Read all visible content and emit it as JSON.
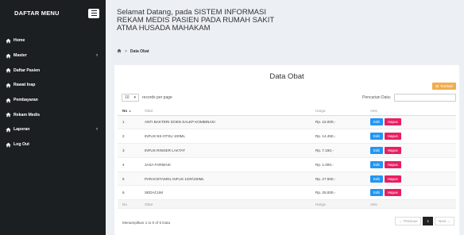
{
  "sidebar": {
    "title": "DAFTAR MENU",
    "items": [
      {
        "label": "Home",
        "caret": ""
      },
      {
        "label": "Master",
        "caret": "›"
      },
      {
        "label": "Daftar Pasien",
        "caret": ""
      },
      {
        "label": "Rawat Inap",
        "caret": ""
      },
      {
        "label": "Pembayaran",
        "caret": ""
      },
      {
        "label": "Rekam Medis",
        "caret": ""
      },
      {
        "label": "Laporan",
        "caret": "›"
      },
      {
        "label": "Log Out",
        "caret": ""
      }
    ]
  },
  "header": {
    "line1": "Selamat Datang, pada SISTEM INFORMASI",
    "line2": "REKAM MEDIS PASIEN PADA RUMAH SAKIT",
    "line3": "ATMA HUSADA MAHAKAM"
  },
  "breadcrumb": {
    "current": "Data Obat"
  },
  "panel": {
    "title": "Data Obat",
    "add_label": "Tambah",
    "length_value": "10",
    "length_suffix": "records per page",
    "search_label": "Pencarian Data:",
    "search_value": ""
  },
  "table": {
    "headers": {
      "no": "No",
      "obat": "Obat",
      "harga": "Harga",
      "aksi": "Aksi"
    },
    "rows": [
      {
        "no": "1",
        "obat": "ANTI BAKTERI DOEN SALEP KOMBINASI",
        "harga": "Rp. 15.000,-"
      },
      {
        "no": "2",
        "obat": "INFUS NS-OTSU 100ML",
        "harga": "Rp. 14.450,-"
      },
      {
        "no": "3",
        "obat": "INFUS RINGER LAKTAT",
        "harga": "Rp. 7.150,-"
      },
      {
        "no": "4",
        "obat": "JASA FARMASI",
        "harga": "Rp. 1.000,-"
      },
      {
        "no": "5",
        "obat": "PARACETAMOL INFUS 1GR/100ML",
        "harga": "Rp. 27.500,-"
      },
      {
        "no": "6",
        "obat": "SEDACUM",
        "harga": "Rp. 25.000,-"
      }
    ],
    "edit_label": "Edit",
    "delete_label": "Hapus"
  },
  "footer": {
    "info": "Menampilkan 1 to 6 of 6 Data",
    "prev": "← Previous",
    "page": "1",
    "next": "Next →"
  },
  "colors": {
    "sidebar": "#1c1f22",
    "edit": "#2196f3",
    "hapus": "#e91e63",
    "tambah": "#f0ad4e"
  }
}
